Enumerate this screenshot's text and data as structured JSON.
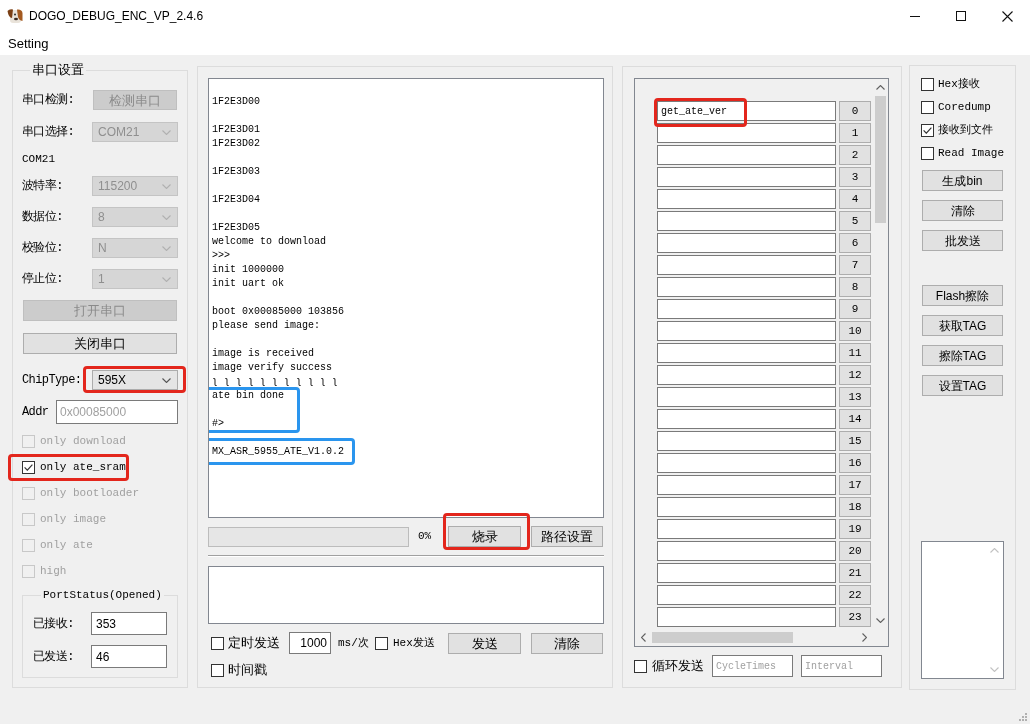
{
  "window": {
    "title": "DOGO_DEBUG_ENC_VP_2.4.6"
  },
  "menu": [
    {
      "label": "Setting"
    }
  ],
  "serial": {
    "title": "串口设置",
    "rows": [
      {
        "kind": "button",
        "label": "串口检测:",
        "value": "检测串口",
        "disabled": true
      },
      {
        "kind": "select",
        "label": "串口选择:",
        "value": "COM21",
        "disabled": true
      },
      {
        "kind": "text",
        "value": "COM21"
      },
      {
        "kind": "select",
        "label": "波特率:",
        "value": "115200",
        "disabled": true
      },
      {
        "kind": "select",
        "label": "数据位:",
        "value": "8",
        "disabled": true
      },
      {
        "kind": "select",
        "label": "校验位:",
        "value": "N",
        "disabled": true
      },
      {
        "kind": "select",
        "label": "停止位:",
        "value": "1",
        "disabled": true
      },
      {
        "kind": "wide_button",
        "value": "打开串口",
        "disabled": true
      },
      {
        "kind": "wide_button",
        "value": "关闭串口",
        "disabled": false
      },
      {
        "kind": "select",
        "label": "ChipType:",
        "value": "595X",
        "disabled": false,
        "color": "#e3261c"
      },
      {
        "kind": "input",
        "label": "Addr",
        "value": "0x00085000",
        "disabled": true
      }
    ],
    "options": [
      {
        "label": "only download",
        "checked": false,
        "disabled": true
      },
      {
        "label": "only ate_sram",
        "checked": true,
        "disabled": false,
        "color": "#e3261c"
      },
      {
        "label": "only bootloader",
        "checked": false,
        "disabled": true
      },
      {
        "label": "only image",
        "checked": false,
        "disabled": true
      },
      {
        "label": "only ate",
        "checked": false,
        "disabled": true
      },
      {
        "label": "high",
        "checked": false,
        "disabled": true
      }
    ],
    "port_status": {
      "title": "PortStatus(Opened)",
      "fields": [
        {
          "label": "已接收:",
          "value": "353"
        },
        {
          "label": "已发送:",
          "value": "46"
        }
      ]
    }
  },
  "console": {
    "log": [
      {
        "text": "1F2E3D00\n\n1F2E3D01\n1F2E3D02\n\n1F2E3D03\n\n1F2E3D04\n\n1F2E3D05\nwelcome to download\n>>>\ninit 1000000\ninit uart ok\n\nboot 0x00085000 103856\nplease send image:\n\nimage is received\nimage verify success\nʅ ʅ ʅ ʅ ʅ ʅ ʅ ʅ ʅ ʅ ʅ"
      },
      {
        "text": "ate bin done\n\n#>",
        "color": "#2a95ee"
      },
      {
        "text": "\nMX_ASR_5955_ATE_V1.0.2",
        "color": "#2a95ee"
      }
    ],
    "progress": {
      "level": 0,
      "reading": "0%"
    },
    "buttons": [
      {
        "label": "烧录",
        "color": "#e3261c"
      },
      {
        "label": "路径设置"
      }
    ],
    "timer_send": {
      "label": "定时发送",
      "checked": false
    },
    "period": {
      "value": "1000"
    },
    "unit": "ms/次",
    "hex_send": {
      "label": "Hex发送",
      "checked": false
    },
    "send_buttons": [
      {
        "label": "发送"
      },
      {
        "label": "清除"
      }
    ],
    "timestamp": {
      "label": "时间戳",
      "checked": false
    }
  },
  "commands": {
    "rows": [
      {
        "value": "get_ate_ver",
        "button": "0",
        "color": "#e3261c"
      },
      {
        "button": "1"
      },
      {
        "button": "2"
      },
      {
        "button": "3"
      },
      {
        "button": "4"
      },
      {
        "button": "5"
      },
      {
        "button": "6"
      },
      {
        "button": "7"
      },
      {
        "button": "8"
      },
      {
        "button": "9"
      },
      {
        "button": "10"
      },
      {
        "button": "11"
      },
      {
        "button": "12"
      },
      {
        "button": "13"
      },
      {
        "button": "14"
      },
      {
        "button": "15"
      },
      {
        "button": "16"
      },
      {
        "button": "17"
      },
      {
        "button": "18"
      },
      {
        "button": "19"
      },
      {
        "button": "20"
      },
      {
        "button": "21"
      },
      {
        "button": "22"
      },
      {
        "button": "23"
      }
    ],
    "loop_send": {
      "label": "循环发送",
      "checked": false
    },
    "cycle_times": {
      "placeholder": "CycleTimes"
    },
    "interval": {
      "placeholder": "Interval"
    }
  },
  "tools": {
    "options": [
      {
        "label": "Hex接收",
        "checked": false
      },
      {
        "label": "Coredump",
        "checked": false
      },
      {
        "label": "接收到文件",
        "checked": true
      },
      {
        "label": "Read Image",
        "checked": false
      }
    ],
    "button_groups": [
      [
        {
          "label": "生成bin"
        },
        {
          "label": "清除"
        },
        {
          "label": "批发送"
        }
      ],
      [
        {
          "label": "Flash擦除"
        },
        {
          "label": "获取TAG"
        },
        {
          "label": "擦除TAG"
        },
        {
          "label": "设置TAG"
        }
      ]
    ]
  }
}
